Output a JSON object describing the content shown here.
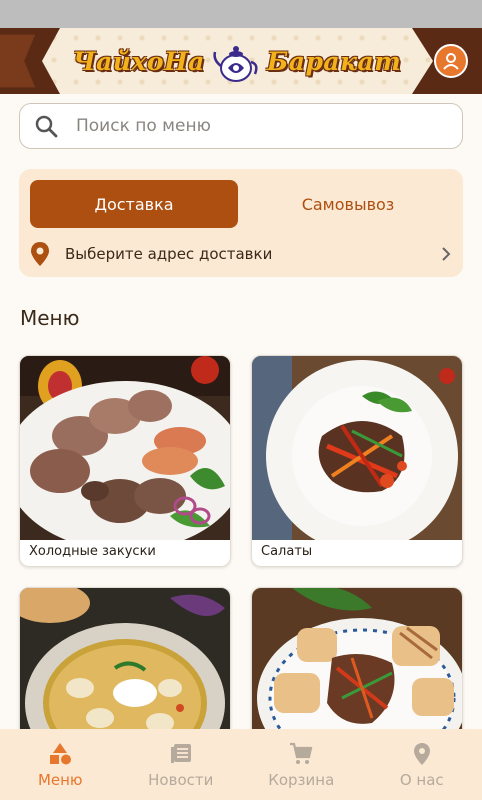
{
  "header": {
    "logo_word_left": "ЧайхоНа",
    "logo_word_right": "Баракат",
    "profile_icon": "user-icon"
  },
  "search": {
    "placeholder": "Поиск по меню",
    "icon": "search-icon"
  },
  "delivery": {
    "tabs": [
      {
        "label": "Доставка",
        "active": true
      },
      {
        "label": "Самовывоз",
        "active": false
      }
    ],
    "address_prompt": "Выберите адрес доставки",
    "address_icon": "location-pin-icon"
  },
  "menu": {
    "title": "Меню",
    "categories": [
      {
        "label": "Холодные закуски"
      },
      {
        "label": "Салаты"
      },
      {
        "label": ""
      },
      {
        "label": ""
      }
    ]
  },
  "bottom_nav": {
    "items": [
      {
        "label": "Меню",
        "icon": "shapes-icon",
        "active": true
      },
      {
        "label": "Новости",
        "icon": "news-icon",
        "active": false
      },
      {
        "label": "Корзина",
        "icon": "cart-icon",
        "active": false
      },
      {
        "label": "О нас",
        "icon": "location-pin-icon",
        "active": false
      }
    ]
  },
  "colors": {
    "accent": "#ad4f11",
    "accent_light": "#e8772e",
    "panel": "#fbe9d4",
    "logo_gold": "#f2b21c"
  }
}
